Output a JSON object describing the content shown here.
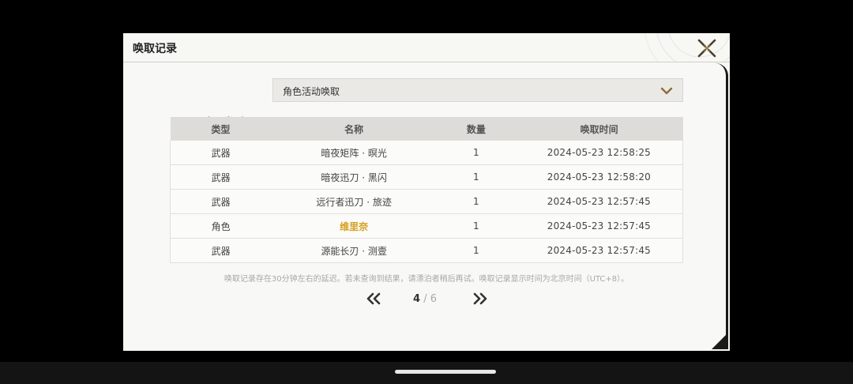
{
  "dialog": {
    "title": "唤取记录",
    "close_icon": "close-x-icon"
  },
  "filter": {
    "label": "唤取类型",
    "selected": "角色活动唤取"
  },
  "table": {
    "columns": [
      "类型",
      "名称",
      "数量",
      "唤取时间"
    ],
    "rows": [
      {
        "type": "武器",
        "name": "暗夜矩阵 · 暝光",
        "qty": "1",
        "time": "2024-05-23 12:58:25"
      },
      {
        "type": "武器",
        "name": "暗夜迅刀 · 黑闪",
        "qty": "1",
        "time": "2024-05-23 12:58:20"
      },
      {
        "type": "武器",
        "name": "远行者迅刀 · 旅迹",
        "qty": "1",
        "time": "2024-05-23 12:57:45"
      },
      {
        "type": "角色",
        "name": "维里奈",
        "qty": "1",
        "time": "2024-05-23 12:57:45"
      },
      {
        "type": "武器",
        "name": "源能长刃 · 测壹",
        "qty": "1",
        "time": "2024-05-23 12:57:45"
      }
    ]
  },
  "notice": "唤取记录存在30分钟左右的延迟。若未查询到结果，请漂泊者稍后再试。唤取记录显示时间为北京时间（UTC+8）。",
  "pagination": {
    "current": "4",
    "separator": "/",
    "total": "6"
  },
  "colors": {
    "highlight": "#d6a01e",
    "accent": "#8c6e3a"
  }
}
